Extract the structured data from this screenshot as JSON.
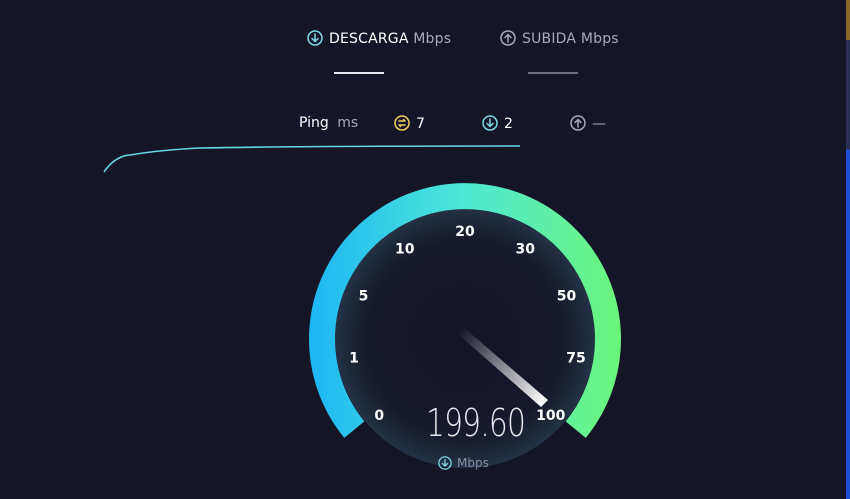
{
  "tabs": {
    "download": {
      "label": "DESCARGA",
      "unit": "Mbps",
      "icon": "download-circle-icon"
    },
    "upload": {
      "label": "SUBIDA",
      "unit": "Mbps",
      "icon": "upload-circle-icon"
    }
  },
  "ping": {
    "label": "Ping",
    "unit": "ms",
    "idle": {
      "value": "7",
      "icon": "ping-idle-icon"
    },
    "download": {
      "value": "2",
      "icon": "download-circle-icon"
    },
    "upload": {
      "value": "—",
      "icon": "upload-circle-icon"
    }
  },
  "gauge": {
    "scale_labels": [
      "0",
      "1",
      "5",
      "10",
      "20",
      "30",
      "50",
      "75",
      "100"
    ],
    "needle_value": 100,
    "readout": "199.60",
    "unit": "Mbps",
    "unit_icon": "download-circle-icon"
  },
  "colors": {
    "background": "#141526",
    "gauge_start": "#1fb6f5",
    "gauge_mid": "#4ee8d6",
    "gauge_end": "#6cf57a",
    "accent_icon": "#7fd9e8",
    "ping_icon": "#f2cf5b",
    "graph_line": "#62d8e6"
  }
}
